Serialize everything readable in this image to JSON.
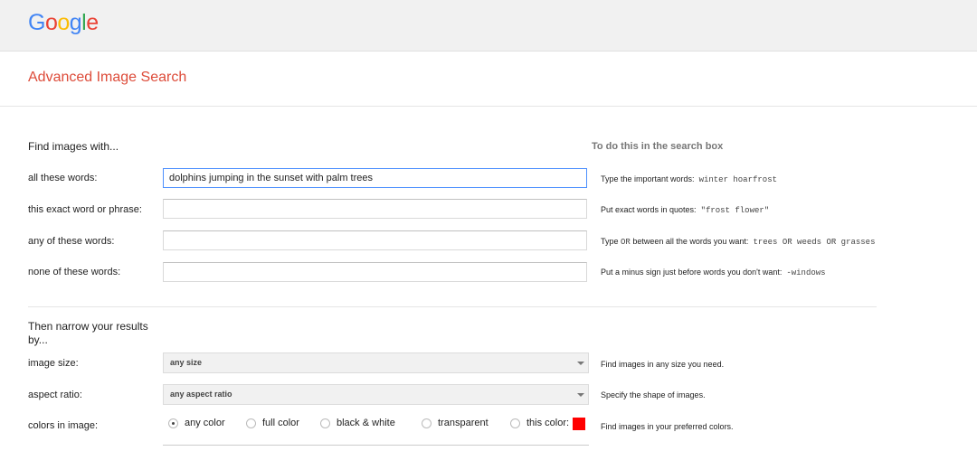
{
  "logo": {
    "letters": [
      "G",
      "o",
      "o",
      "g",
      "l",
      "e"
    ],
    "colors": [
      "#4285f4",
      "#ea4335",
      "#fbbc05",
      "#4285f4",
      "#34a853",
      "#ea4335"
    ]
  },
  "page_title": "Advanced Image Search",
  "find_section": {
    "heading": "Find images with...",
    "right_heading": "To do this in the search box",
    "rows": [
      {
        "label": "all these words:",
        "value": "dolphins jumping in the sunset with palm trees",
        "hint_text": "Type the important words:",
        "hint_example": "winter hoarfrost"
      },
      {
        "label": "this exact word or phrase:",
        "value": "",
        "hint_text": "Put exact words in quotes:",
        "hint_example": "\"frost flower\""
      },
      {
        "label": "any of these words:",
        "value": "",
        "hint_text": "Type",
        "hint_or": "OR",
        "hint_text2": "between all the words you want:",
        "hint_example": "trees OR weeds OR grasses"
      },
      {
        "label": "none of these words:",
        "value": "",
        "hint_text": "Put a minus sign just before words you don't want:",
        "hint_example": "-windows"
      }
    ]
  },
  "narrow_section": {
    "heading_line1": "Then narrow your results",
    "heading_line2": "by...",
    "image_size": {
      "label": "image size:",
      "selected": "any size",
      "hint": "Find images in any size you need."
    },
    "aspect_ratio": {
      "label": "aspect ratio:",
      "selected": "any aspect ratio",
      "hint": "Specify the shape of images."
    },
    "colors": {
      "label": "colors in image:",
      "options": [
        "any color",
        "full color",
        "black & white",
        "transparent",
        "this color:"
      ],
      "selected": "any color",
      "swatch_color": "#ff0000",
      "hint": "Find images in your preferred colors."
    }
  }
}
